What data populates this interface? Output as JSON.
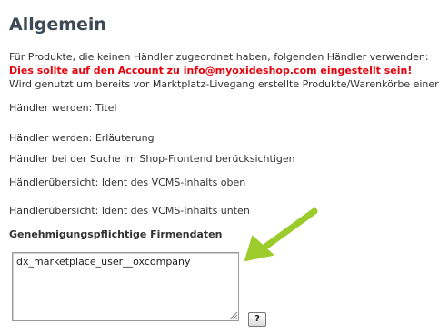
{
  "section": {
    "title": "Allgemein"
  },
  "lines": {
    "intro": "Für Produkte, die keinen Händler zugeordnet haben, folgenden Händler verwenden:",
    "warning": "Dies sollte auf den Account zu info@myoxideshop.com eingestellt sein!",
    "note": "Wird genutzt um bereits vor Marktplatz-Livegang erstellte Produkte/Warenkörbe einer",
    "title_setting": "Händler werden: Titel",
    "explanation_setting": "Händler werden: Erläuterung",
    "search_setting": "Händler bei der Suche im Shop-Frontend berücksichtigen",
    "vcms_top_setting": "Händlerübersicht: Ident des VCMS-Inhalts oben",
    "vcms_bottom_setting": "Händlerübersicht: Ident des VCMS-Inhalts unten",
    "company_data_label": "Genehmigungspflichtige Firmendaten"
  },
  "company_field": {
    "value": "dx_marketplace_user__oxcompany"
  },
  "help_button": {
    "label": "?"
  },
  "colors": {
    "warning": "#e8000b",
    "arrow": "#9ccc2c",
    "heading": "#3d4a55"
  },
  "icons": {
    "arrow": "green-pointer-arrow-icon",
    "resize": "resize-grip-icon"
  }
}
